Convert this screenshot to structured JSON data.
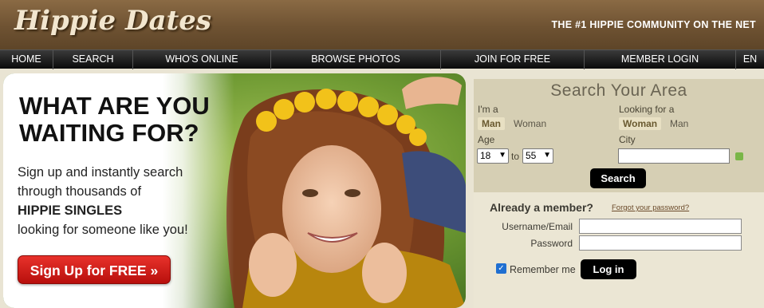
{
  "header": {
    "logo": "Hippie Dates",
    "tagline": "THE #1 HIPPIE COMMUNITY ON THE NET"
  },
  "nav": {
    "items": [
      "HOME",
      "SEARCH",
      "WHO'S ONLINE",
      "BROWSE PHOTOS",
      "JOIN FOR FREE",
      "MEMBER LOGIN",
      "EN"
    ]
  },
  "hero": {
    "title_line1": "WHAT ARE YOU",
    "title_line2": "WAITING FOR?",
    "text_line1": "Sign up and instantly search",
    "text_line2": "through thousands of",
    "text_bold": "HIPPIE SINGLES",
    "text_line4": "looking for someone like you!",
    "signup_label": "Sign Up for FREE »"
  },
  "search": {
    "title": "Search Your Area",
    "im_a_label": "I'm a",
    "im_a_options": [
      "Man",
      "Woman"
    ],
    "im_a_selected": "Man",
    "looking_label": "Looking for a",
    "looking_options": [
      "Woman",
      "Man"
    ],
    "looking_selected": "Woman",
    "age_label": "Age",
    "age_min": "18",
    "age_to": "to",
    "age_max": "55",
    "city_label": "City",
    "city_value": "",
    "button_label": "Search"
  },
  "login": {
    "question": "Already a member?",
    "forgot": "Forgot your password?",
    "username_label": "Username/Email",
    "password_label": "Password",
    "remember_label": "Remember me",
    "remember_checked": true,
    "button_label": "Log in"
  },
  "colors": {
    "header_brown": "#6e5232",
    "nav_black": "#0b0b0b",
    "signup_red": "#d41f1a",
    "panel_tan": "#d6cfb4"
  }
}
